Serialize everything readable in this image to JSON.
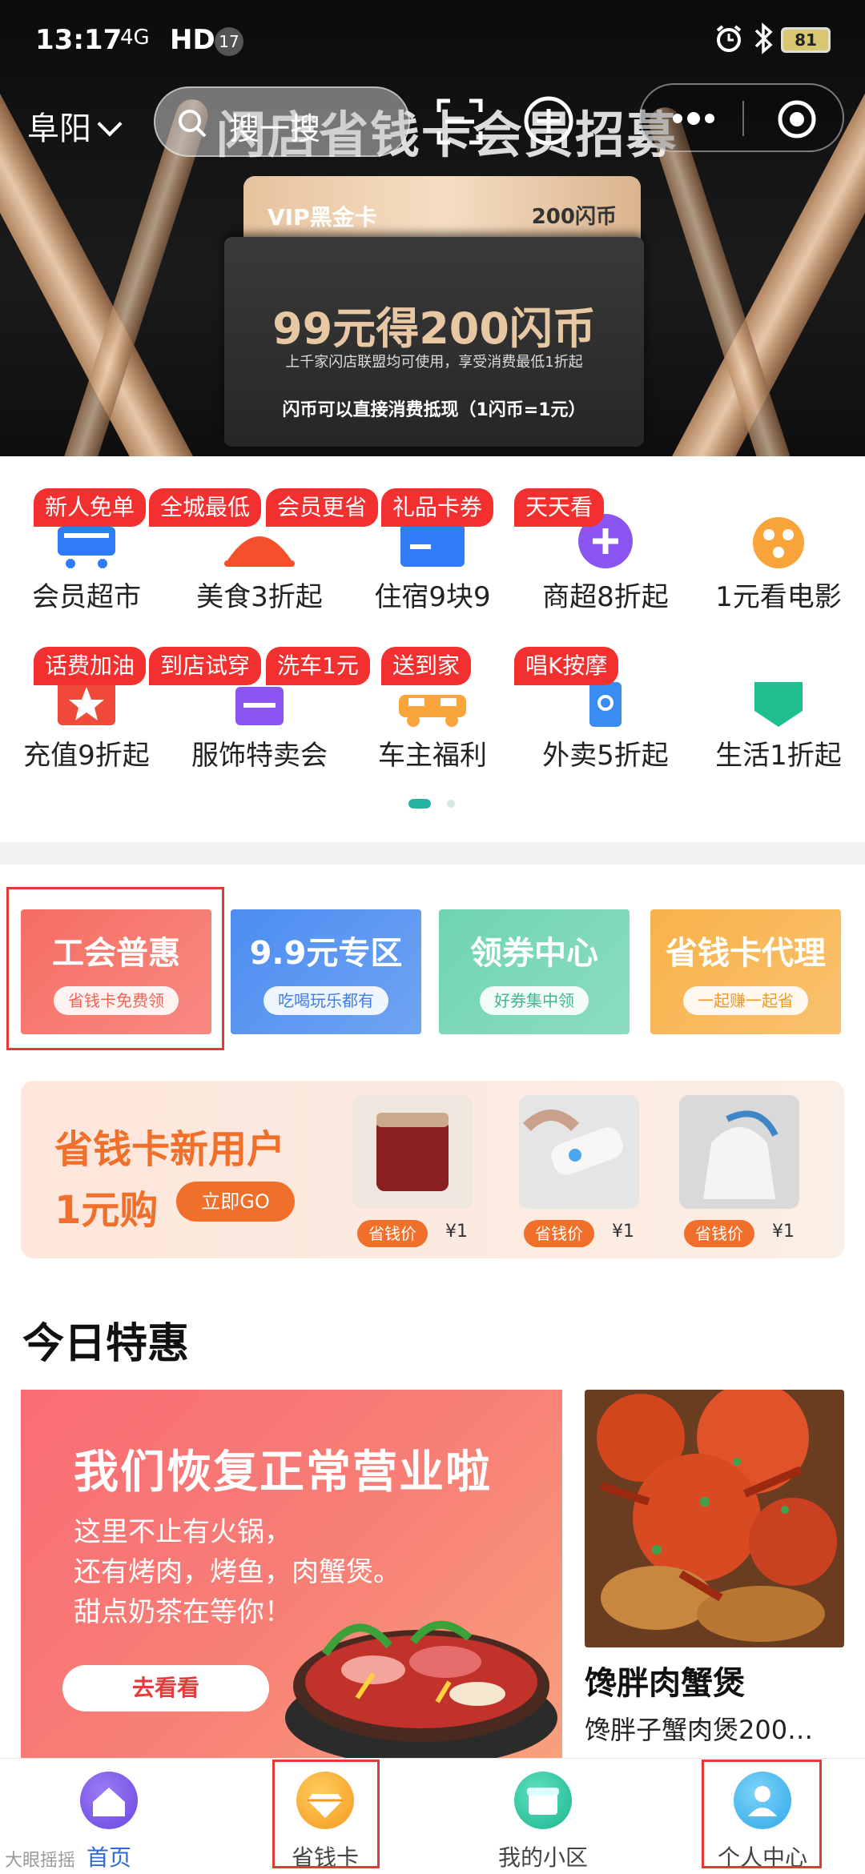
{
  "status_bar": {
    "time": "13:17",
    "network": "4G",
    "hd": "HD",
    "badge": "17",
    "battery": "81"
  },
  "header": {
    "location": "阜阳",
    "search_placeholder": "搜一搜",
    "banner_title": "闪店省钱卡会员招募"
  },
  "vip_card": {
    "name": "VIP黑金卡",
    "coins": "200闪币",
    "offer": "99元得200闪币",
    "desc": "上千家闪店联盟均可使用，享受消费最低1折起",
    "rule": "闪币可以直接消费抵现（1闪币=1元）"
  },
  "categories": [
    {
      "tag": "新人免单",
      "label": "会员超市",
      "color": "#2f7cf6"
    },
    {
      "tag": "全城最低",
      "label": "美食3折起",
      "color": "#f5502b"
    },
    {
      "tag": "会员更省",
      "label": "住宿9块9",
      "color": "#2f7cf6"
    },
    {
      "tag": "礼品卡券",
      "label": "商超8折起",
      "color": "#8a55f0"
    },
    {
      "tag": "天天看",
      "label": "1元看电影",
      "color": "#f8a43a"
    },
    {
      "tag": "话费加油",
      "label": "充值9折起",
      "color": "#f04a3a"
    },
    {
      "tag": "到店试穿",
      "label": "服饰特卖会",
      "color": "#8a55f0"
    },
    {
      "tag": "洗车1元",
      "label": "车主福利",
      "color": "#f8a43a"
    },
    {
      "tag": "送到家",
      "label": "外卖5折起",
      "color": "#3a8cf2"
    },
    {
      "tag": "唱K按摩",
      "label": "生活1折起",
      "color": "#1fbf8f"
    }
  ],
  "promos": [
    {
      "title": "工会普惠",
      "sub": "省钱卡免费领",
      "bg": "#f66d63",
      "sub_color": "#f06456"
    },
    {
      "title": "9.9元专区",
      "sub": "吃喝玩乐都有",
      "bg": "#4c8df0",
      "sub_color": "#3f7ee8"
    },
    {
      "title": "领券中心",
      "sub": "好券集中领",
      "bg": "#6fd4b2",
      "sub_color": "#3fb892"
    },
    {
      "title": "省钱卡代理",
      "sub": "一起赚一起省",
      "bg": "#f8b24a",
      "sub_color": "#ee9a2a"
    }
  ],
  "new_user": {
    "title": "省钱卡新用户",
    "price": "1元购",
    "go": "立即GO",
    "products": [
      {
        "tag": "省钱价",
        "price": "¥1"
      },
      {
        "tag": "省钱价",
        "price": "¥1"
      },
      {
        "tag": "省钱价",
        "price": "¥1"
      }
    ]
  },
  "today": {
    "title": "今日特惠",
    "big": {
      "headline": "我们恢复正常营业啦",
      "line1": "这里不止有火锅，",
      "line2": "还有烤肉，烤鱼，肉蟹煲。",
      "line3": "甜点奶茶在等你！",
      "button": "去看看"
    },
    "side": {
      "name": "馋胖肉蟹煲",
      "desc": "馋胖子蟹肉煲200…"
    }
  },
  "tabs": [
    {
      "label": "首页",
      "icon": "home-icon"
    },
    {
      "label": "省钱卡",
      "icon": "diamond-icon"
    },
    {
      "label": "我的小区",
      "icon": "store-icon"
    },
    {
      "label": "个人中心",
      "icon": "user-icon"
    }
  ],
  "watermark": "大眼摇摇"
}
